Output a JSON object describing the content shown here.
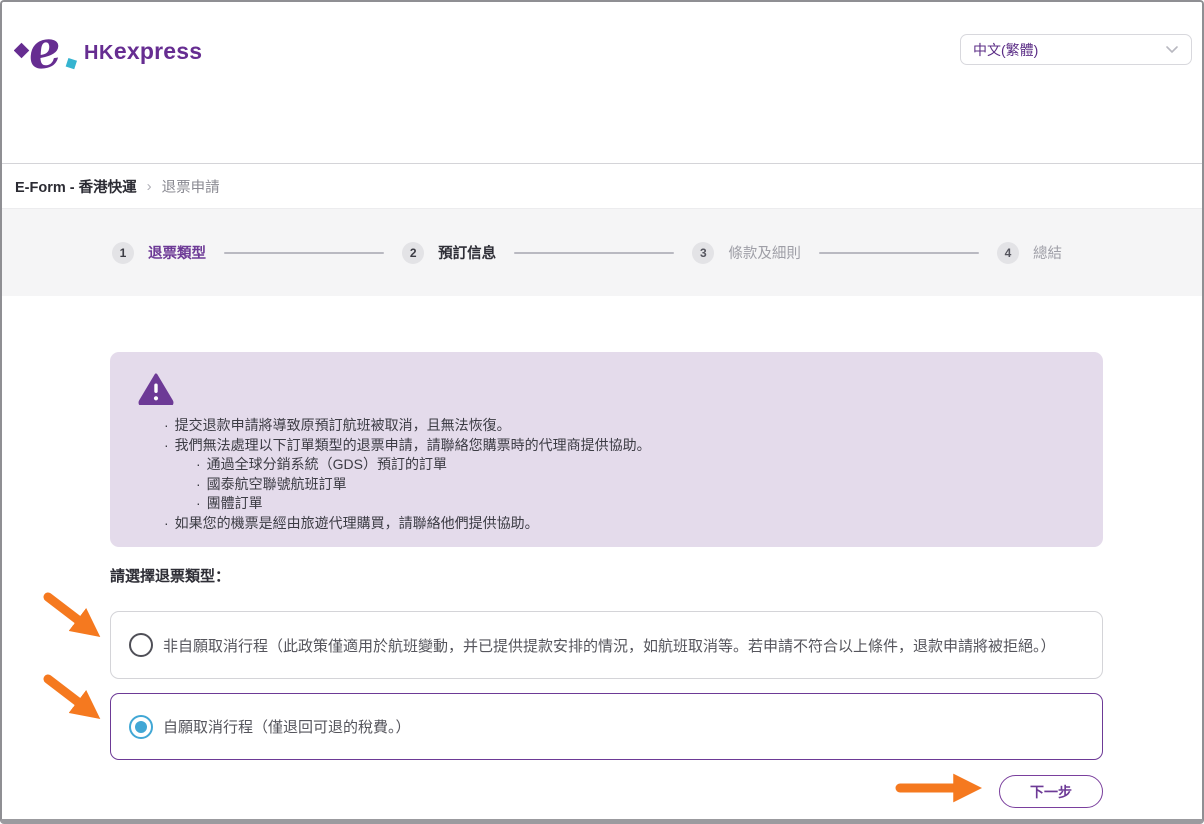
{
  "header": {
    "logo_hk": "HK",
    "logo_express": "express",
    "language_selector": {
      "value": "中文(繁體)"
    }
  },
  "breadcrumb": {
    "root": "E-Form - 香港快運",
    "separator": "›",
    "current": "退票申請"
  },
  "stepper": {
    "steps": [
      {
        "number": "1",
        "label": "退票類型",
        "state": "active"
      },
      {
        "number": "2",
        "label": "預訂信息",
        "state": "next"
      },
      {
        "number": "3",
        "label": "條款及細則",
        "state": "inactive"
      },
      {
        "number": "4",
        "label": "總結",
        "state": "inactive"
      }
    ]
  },
  "notice": {
    "icon": "warning-triangle-icon",
    "bullet": "·",
    "items": [
      {
        "level": 0,
        "text": "提交退款申請將導致原預訂航班被取消，且無法恢復。"
      },
      {
        "level": 0,
        "text": "我們無法處理以下訂單類型的退票申請，請聯絡您購票時的代理商提供協助。"
      },
      {
        "level": 1,
        "text": "通過全球分銷系統（GDS）預訂的訂單"
      },
      {
        "level": 1,
        "text": "國泰航空聯號航班訂單"
      },
      {
        "level": 1,
        "text": "團體訂單"
      },
      {
        "level": 0,
        "text": "如果您的機票是經由旅遊代理購買，請聯絡他們提供協助。"
      }
    ]
  },
  "form": {
    "prompt": "請選擇退票類型：",
    "options": [
      {
        "label": "非自願取消行程（此政策僅適用於航班變動，并已提供提款安排的情況，如航班取消等。若申請不符合以上條件，退款申請將被拒絕。）",
        "selected": false
      },
      {
        "label": "自願取消行程（僅退回可退的稅費。）",
        "selected": true
      }
    ],
    "next_button": "下一步"
  },
  "colors": {
    "brand_purple": "#662d91",
    "accent_purple": "#6d3a96",
    "notice_bg": "#e4dbeb",
    "radio_selected_blue": "#41a7d5",
    "annotation_orange": "#f5791f"
  }
}
